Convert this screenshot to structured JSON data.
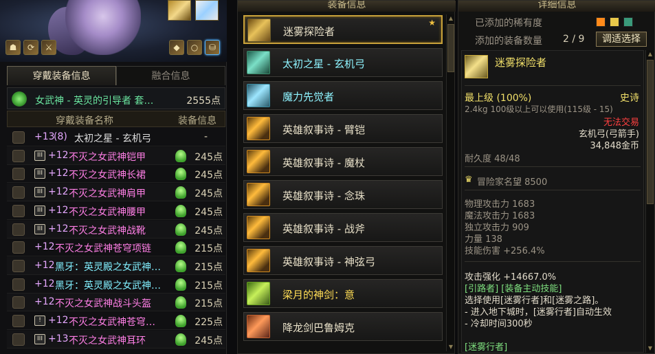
{
  "left": {
    "tabs": [
      "穿戴装备信息",
      "融合信息"
    ],
    "set_name": "女武神 - 英灵的引导者  套…",
    "set_points": "2555点",
    "col_name": "穿戴装备名称",
    "col_info": "装备信息",
    "rows": [
      {
        "enh": "+13",
        "extra": "(8)",
        "name": "太初之星 - 玄机弓",
        "color": "nm-white",
        "points": "-",
        "badge": "",
        "helm": false
      },
      {
        "enh": "+12",
        "extra": "",
        "name": "不灭之女武神铠甲",
        "color": "nm-pink",
        "points": "245点",
        "badge": "III",
        "helm": true
      },
      {
        "enh": "+12",
        "extra": "",
        "name": "不灭之女武神长裙",
        "color": "nm-pink",
        "points": "245点",
        "badge": "III",
        "helm": true
      },
      {
        "enh": "+12",
        "extra": "",
        "name": "不灭之女武神肩甲",
        "color": "nm-pink",
        "points": "245点",
        "badge": "III",
        "helm": true
      },
      {
        "enh": "+12",
        "extra": "",
        "name": "不灭之女武神腰甲",
        "color": "nm-pink",
        "points": "245点",
        "badge": "III",
        "helm": true
      },
      {
        "enh": "+12",
        "extra": "",
        "name": "不灭之女武神战靴",
        "color": "nm-pink",
        "points": "245点",
        "badge": "III",
        "helm": true
      },
      {
        "enh": "+12",
        "extra": "",
        "name": "不灭之女武神苍穹项链",
        "color": "nm-pink",
        "points": "215点",
        "badge": "",
        "helm": true
      },
      {
        "enh": "+12",
        "extra": "",
        "name": "黑牙：英灵殿之女武神…",
        "color": "nm-cyan",
        "points": "215点",
        "badge": "",
        "helm": true
      },
      {
        "enh": "+12",
        "extra": "",
        "name": "黑牙：英灵殿之女武神…",
        "color": "nm-cyan",
        "points": "215点",
        "badge": "",
        "helm": true
      },
      {
        "enh": "+12",
        "extra": "",
        "name": "不灭之女武神战斗头盔",
        "color": "nm-pink",
        "points": "215点",
        "badge": "",
        "helm": true
      },
      {
        "enh": "+12",
        "extra": "",
        "name": "不灭之女武神苍穹…",
        "color": "nm-pink",
        "points": "225点",
        "badge": "!",
        "helm": true
      },
      {
        "enh": "+13",
        "extra": "",
        "name": "不灭之女武神耳环",
        "color": "nm-pink",
        "points": "245点",
        "badge": "III",
        "helm": true
      }
    ]
  },
  "middle": {
    "title": "装备信息",
    "items": [
      {
        "name": "迷雾探险者",
        "color": "white",
        "icon": "gold",
        "selected": true,
        "star": "★"
      },
      {
        "name": "太初之星 - 玄机弓",
        "color": "cyan",
        "icon": "teal",
        "selected": false,
        "star": ""
      },
      {
        "name": "魔力先觉者",
        "color": "cyan",
        "icon": "sky",
        "selected": false,
        "star": ""
      },
      {
        "name": "英雄叙事诗 - 臂铠",
        "color": "white",
        "icon": "epic",
        "selected": false,
        "star": ""
      },
      {
        "name": "英雄叙事诗 - 魔杖",
        "color": "white",
        "icon": "epic",
        "selected": false,
        "star": ""
      },
      {
        "name": "英雄叙事诗 - 念珠",
        "color": "white",
        "icon": "epic",
        "selected": false,
        "star": ""
      },
      {
        "name": "英雄叙事诗 - 战斧",
        "color": "white",
        "icon": "epic",
        "selected": false,
        "star": ""
      },
      {
        "name": "英雄叙事诗 - 神弦弓",
        "color": "white",
        "icon": "epic",
        "selected": false,
        "star": ""
      },
      {
        "name": "梁月的神剑：意",
        "color": "yellow",
        "icon": "green",
        "selected": false,
        "star": ""
      },
      {
        "name": "降龙剑巴鲁姆克",
        "color": "white",
        "icon": "red",
        "selected": false,
        "star": ""
      }
    ]
  },
  "right": {
    "title": "详细信息",
    "rarity_label": "已添加的稀有度",
    "rarity_colors": [
      "#ff8a1a",
      "#e8c84a",
      "#3a9a7a"
    ],
    "count_label": "添加的装备数量",
    "count_value": "2 / 9",
    "adjust_button": "调适选择",
    "item_name": "迷雾探险者",
    "top_level": "最上级 (100%)",
    "grade": "史诗",
    "weight_req": "2.4kg  100级以上可以使用(115级 - 15)",
    "trade": "无法交易",
    "type": "玄机弓(弓箭手)",
    "price": "34,848金币",
    "durability": "耐久度 48/48",
    "fame": "冒险家名望 8500",
    "stats": [
      "物理攻击力 1683",
      "魔法攻击力 1683",
      "独立攻击力 909",
      "力量 138",
      "技能伤害 +256.4%"
    ],
    "attack_boost": "攻击强化 +14667.0%",
    "skill_lines": [
      "[引路者] [装备主动技能]",
      "选择使用[迷雾行者]和[迷雾之路]。",
      "- 进入地下城时，[迷雾行者]自动生效",
      "- 冷却时间300秒"
    ],
    "footer_label": "[迷雾行者]"
  }
}
